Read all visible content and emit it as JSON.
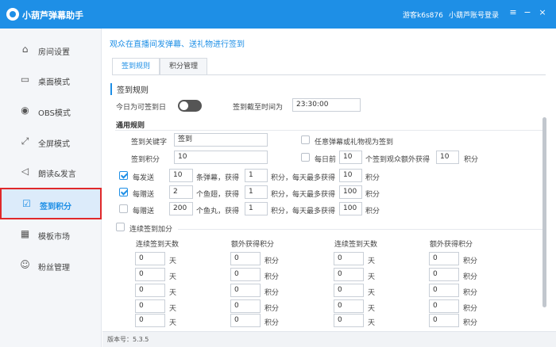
{
  "app": {
    "title": "小葫芦弹幕助手",
    "user": "游客k6s876",
    "login": "小葫芦账号登录",
    "menu_icon": "≡",
    "minimize_icon": "−",
    "close_icon": "×"
  },
  "sidebar": {
    "items": [
      {
        "label": "房间设置",
        "icon": "home-icon",
        "glyph": "⌂"
      },
      {
        "label": "桌面模式",
        "icon": "monitor-icon",
        "glyph": "▭"
      },
      {
        "label": "OBS模式",
        "icon": "obs-icon",
        "glyph": "◉"
      },
      {
        "label": "全屏模式",
        "icon": "fullscreen-icon",
        "glyph": "⤢"
      },
      {
        "label": "朗读&发言",
        "icon": "speaker-icon",
        "glyph": "◁"
      },
      {
        "label": "签到积分",
        "icon": "calendar-icon",
        "glyph": "☑"
      },
      {
        "label": "模板市场",
        "icon": "market-icon",
        "glyph": "▦"
      },
      {
        "label": "粉丝管理",
        "icon": "fans-icon",
        "glyph": "☺"
      }
    ]
  },
  "main": {
    "headline": "观众在直播间发弹幕、送礼物进行签到",
    "tabs": [
      "签到规则",
      "积分管理"
    ],
    "section_title": "签到规则",
    "today_label": "今日为可签到日",
    "deadline_label": "签到截至时间为",
    "deadline_value": "23:30:00",
    "general_title": "通用规则",
    "keyword_label": "签到关键字",
    "keyword_value": "签到",
    "points_label": "签到积分",
    "points_value": "10",
    "any_danmu_label": "任意弹幕或礼物视为签到",
    "daily_first_label": "每日前",
    "daily_first_value": "10",
    "daily_first_text": "个签到观众额外获得",
    "daily_first_points": "10",
    "points_unit": "积分",
    "rows": [
      {
        "label": "每发送",
        "n": "10",
        "unit": "条弹幕，获得",
        "pts": "1",
        "mid": "积分，每天最多获得",
        "max": "10",
        "end": "积分"
      },
      {
        "label": "每赠送",
        "n": "2",
        "unit": "个鱼翅，获得",
        "pts": "1",
        "mid": "积分，每天最多获得",
        "max": "100",
        "end": "积分"
      },
      {
        "label": "每赠送",
        "n": "200",
        "unit": "个鱼丸，获得",
        "pts": "1",
        "mid": "积分，每天最多获得",
        "max": "100",
        "end": "积分"
      }
    ],
    "streak_label": "连续签到加分",
    "table_headers": [
      "连续签到天数",
      "额外获得积分",
      "连续签到天数",
      "额外获得积分"
    ],
    "day_unit": "天",
    "pts_unit": "积分",
    "table_rows": [
      [
        "0",
        "0",
        "0",
        "0"
      ],
      [
        "0",
        "0",
        "0",
        "0"
      ],
      [
        "0",
        "0",
        "0",
        "0"
      ],
      [
        "0",
        "0",
        "0",
        "0"
      ],
      [
        "0",
        "0",
        "0",
        "0"
      ]
    ]
  },
  "footer": {
    "version": "版本号：5.3.5"
  }
}
